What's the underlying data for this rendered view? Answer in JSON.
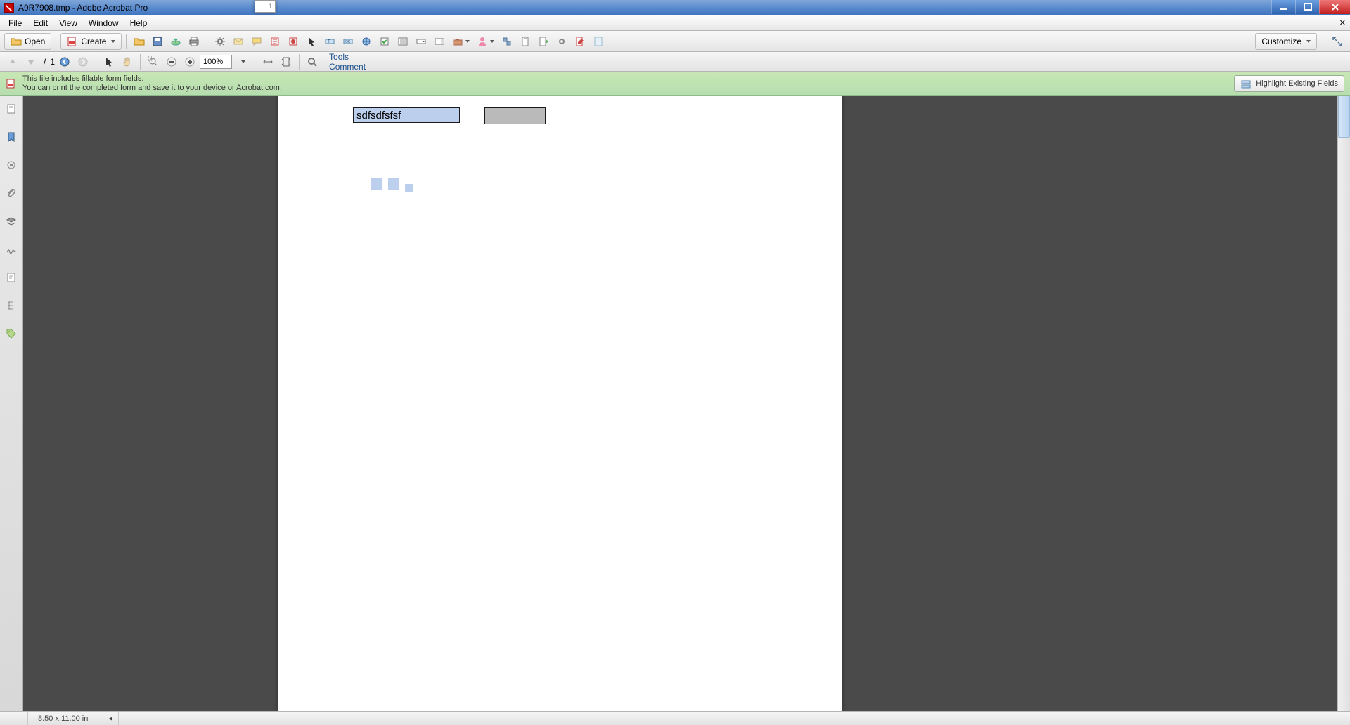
{
  "window": {
    "title": "A9R7908.tmp - Adobe Acrobat Pro"
  },
  "menu": {
    "file": "File",
    "edit": "Edit",
    "view": "View",
    "window": "Window",
    "help": "Help"
  },
  "toolbar": {
    "open": "Open",
    "create": "Create",
    "customize": "Customize"
  },
  "nav": {
    "page_current": "1",
    "page_sep": "/",
    "page_total": "1",
    "zoom": "100%"
  },
  "rightlinks": {
    "tools": "Tools",
    "comment": "Comment"
  },
  "infobar": {
    "line1": "This file includes fillable form fields.",
    "line2": "You can print the completed form and save it to your device or Acrobat.com.",
    "highlight": "Highlight Existing Fields"
  },
  "form": {
    "field1_value": "sdfsdfsfsf",
    "field2_value": ""
  },
  "status": {
    "page_size": "8.50 x 11.00 in"
  }
}
